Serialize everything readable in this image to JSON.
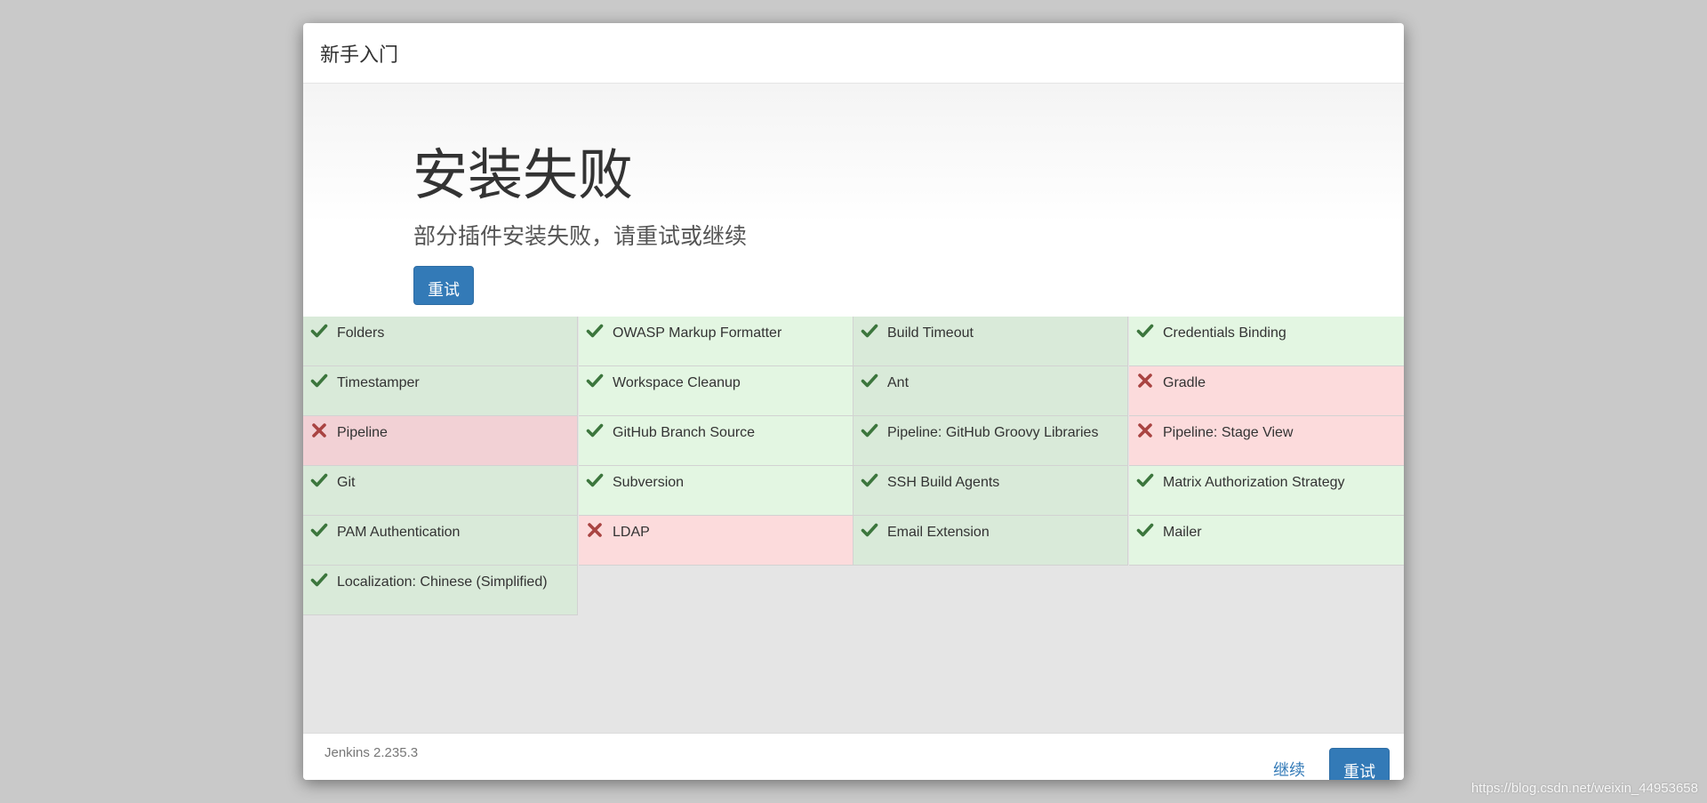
{
  "header": {
    "title": "新手入门"
  },
  "hero": {
    "title": "安装失败",
    "subtitle": "部分插件安装失败，请重试或继续",
    "retry_label": "重试"
  },
  "plugins": [
    {
      "name": "Folders",
      "status": "success"
    },
    {
      "name": "OWASP Markup Formatter",
      "status": "success"
    },
    {
      "name": "Build Timeout",
      "status": "success"
    },
    {
      "name": "Credentials Binding",
      "status": "success"
    },
    {
      "name": "Timestamper",
      "status": "success"
    },
    {
      "name": "Workspace Cleanup",
      "status": "success"
    },
    {
      "name": "Ant",
      "status": "success"
    },
    {
      "name": "Gradle",
      "status": "failed"
    },
    {
      "name": "Pipeline",
      "status": "failed"
    },
    {
      "name": "GitHub Branch Source",
      "status": "success"
    },
    {
      "name": "Pipeline: GitHub Groovy Libraries",
      "status": "success"
    },
    {
      "name": "Pipeline: Stage View",
      "status": "failed"
    },
    {
      "name": "Git",
      "status": "success"
    },
    {
      "name": "Subversion",
      "status": "success"
    },
    {
      "name": "SSH Build Agents",
      "status": "success"
    },
    {
      "name": "Matrix Authorization Strategy",
      "status": "success"
    },
    {
      "name": "PAM Authentication",
      "status": "success"
    },
    {
      "name": "LDAP",
      "status": "failed"
    },
    {
      "name": "Email Extension",
      "status": "success"
    },
    {
      "name": "Mailer",
      "status": "success"
    },
    {
      "name": "Localization: Chinese (Simplified)",
      "status": "success"
    }
  ],
  "footer": {
    "version": "Jenkins 2.235.3",
    "continue_label": "继续",
    "retry_label": "重试"
  },
  "watermark": "https://blog.csdn.net/weixin_44953658",
  "colors": {
    "success_icon": "#3c763d",
    "failed_icon": "#a94442",
    "primary": "#337ab7"
  },
  "icons": {
    "success": "check-icon",
    "failed": "times-icon"
  }
}
